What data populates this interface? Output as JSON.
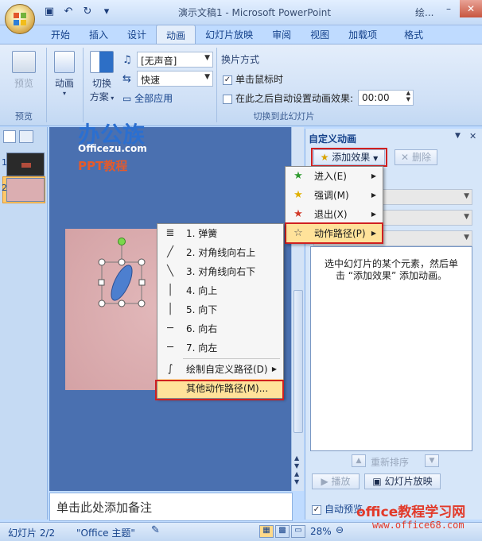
{
  "window": {
    "title": "演示文稿1 - Microsoft PowerPoint",
    "right_fragment": "绘..."
  },
  "window_controls": {
    "minimize": "–",
    "close": "✕"
  },
  "tabs": [
    "开始",
    "插入",
    "设计",
    "动画",
    "幻灯片放映",
    "审阅",
    "视图",
    "加载项",
    "格式"
  ],
  "active_tab": "动画",
  "ribbon": {
    "preview_label": "预览",
    "preview_group": "预览",
    "animation_label": "动画",
    "switch_label_1": "切换",
    "switch_label_2": "方案",
    "sound_value": "[无声音]",
    "speed_value": "快速",
    "apply_all_label": "全部应用",
    "advance_title": "换片方式",
    "on_click_label": "单击鼠标时",
    "auto_after_label": "在此之后自动设置动画效果:",
    "auto_time": "00:00",
    "group_label": "切换到此幻灯片"
  },
  "slides": [
    {
      "num": "1"
    },
    {
      "num": "2"
    }
  ],
  "watermark": {
    "logo": "办公族",
    "url": "Officezu.com",
    "ppt": "PPT教程"
  },
  "notes_placeholder": "单击此处添加备注",
  "task_pane": {
    "title": "自定义动画",
    "add_effect_label": "添加效果",
    "delete_label": "删除",
    "empty_msg": "选中幻灯片的某个元素，然后单击 “添加效果” 添加动画。",
    "reorder_label": "重新排序",
    "play_label": "播放",
    "slideshow_label": "幻灯片放映",
    "autopreview_label": "自动预览"
  },
  "effect_menu": [
    {
      "label": "进入(E)",
      "icon": "star-green-icon"
    },
    {
      "label": "强调(M)",
      "icon": "star-yellow-icon"
    },
    {
      "label": "退出(X)",
      "icon": "star-red-icon"
    },
    {
      "label": "动作路径(P)",
      "icon": "star-outline-icon"
    }
  ],
  "path_menu": [
    {
      "label": "1. 弹簧",
      "icon": "spring-icon"
    },
    {
      "label": "2. 对角线向右上",
      "icon": "diag-up-icon"
    },
    {
      "label": "3. 对角线向右下",
      "icon": "diag-down-icon"
    },
    {
      "label": "4. 向上",
      "icon": "vertical-icon"
    },
    {
      "label": "5. 向下",
      "icon": "vertical-icon"
    },
    {
      "label": "6. 向右",
      "icon": "horizontal-icon"
    },
    {
      "label": "7. 向左",
      "icon": "horizontal-icon"
    },
    {
      "label": "绘制自定义路径(D)",
      "icon": "freeform-icon"
    },
    {
      "label": "其他动作路径(M)...",
      "icon": ""
    }
  ],
  "statusbar": {
    "slide_info": "幻灯片 2/2",
    "theme": "\"Office 主题\"",
    "zoom": "28%"
  },
  "watermark_bottom": {
    "text": "office教程学习网",
    "url": "www.office68.com"
  },
  "colors": {
    "accent": "#d02020",
    "ribbon_bg": "#dbe8f8",
    "slide_bg": "#d9a8ab",
    "shape_fill": "#4d7fcf"
  }
}
